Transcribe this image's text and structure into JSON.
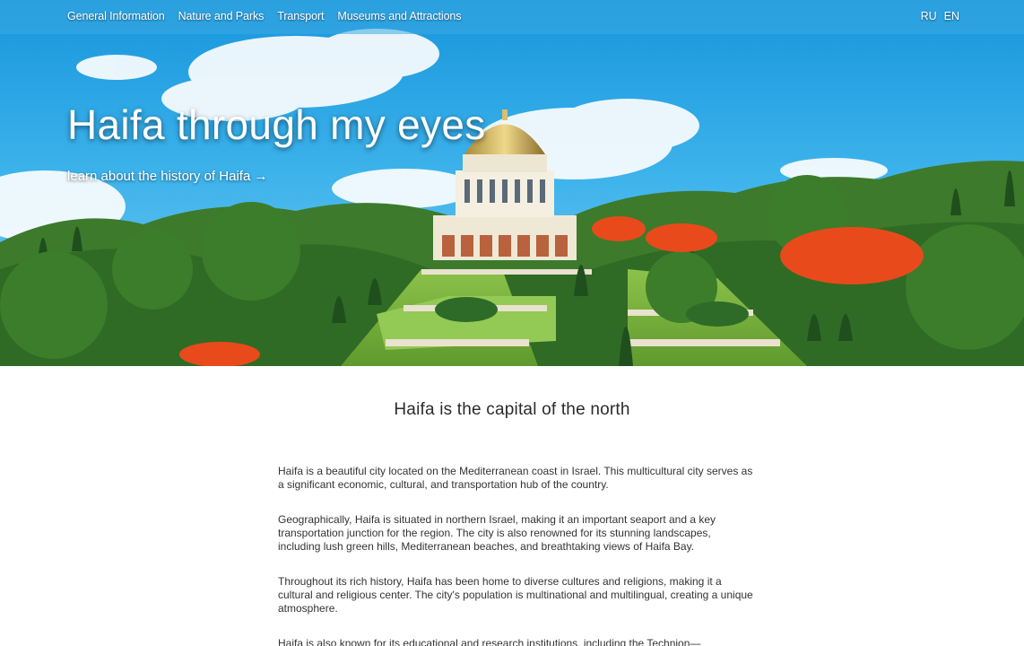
{
  "nav": {
    "items": [
      {
        "label": "General Information"
      },
      {
        "label": "Nature and Parks"
      },
      {
        "label": "Transport"
      },
      {
        "label": "Museums and Attractions"
      }
    ],
    "languages": [
      {
        "label": "RU"
      },
      {
        "label": "EN"
      }
    ]
  },
  "hero": {
    "title": "Haifa through my eyes",
    "link": "learn about the history of Haifa →"
  },
  "main": {
    "heading": "Haifa is the capital of the north",
    "paragraphs": [
      "Haifa is a beautiful city located on the Mediterranean coast in Israel. This multicultural city serves as a significant economic, cultural, and transportation hub of the country.",
      "Geographically, Haifa is situated in northern Israel, making it an important seaport and a key transportation junction for the region. The city is also renowned for its stunning landscapes, including lush green hills, Mediterranean beaches, and breathtaking views of Haifa Bay.",
      "Throughout its rich history, Haifa has been home to diverse cultures and religions, making it a cultural and religious center. The city's population is multinational and multilingual, creating a unique atmosphere.",
      "Haifa is also known for its educational and research institutions, including the Technion—"
    ]
  }
}
